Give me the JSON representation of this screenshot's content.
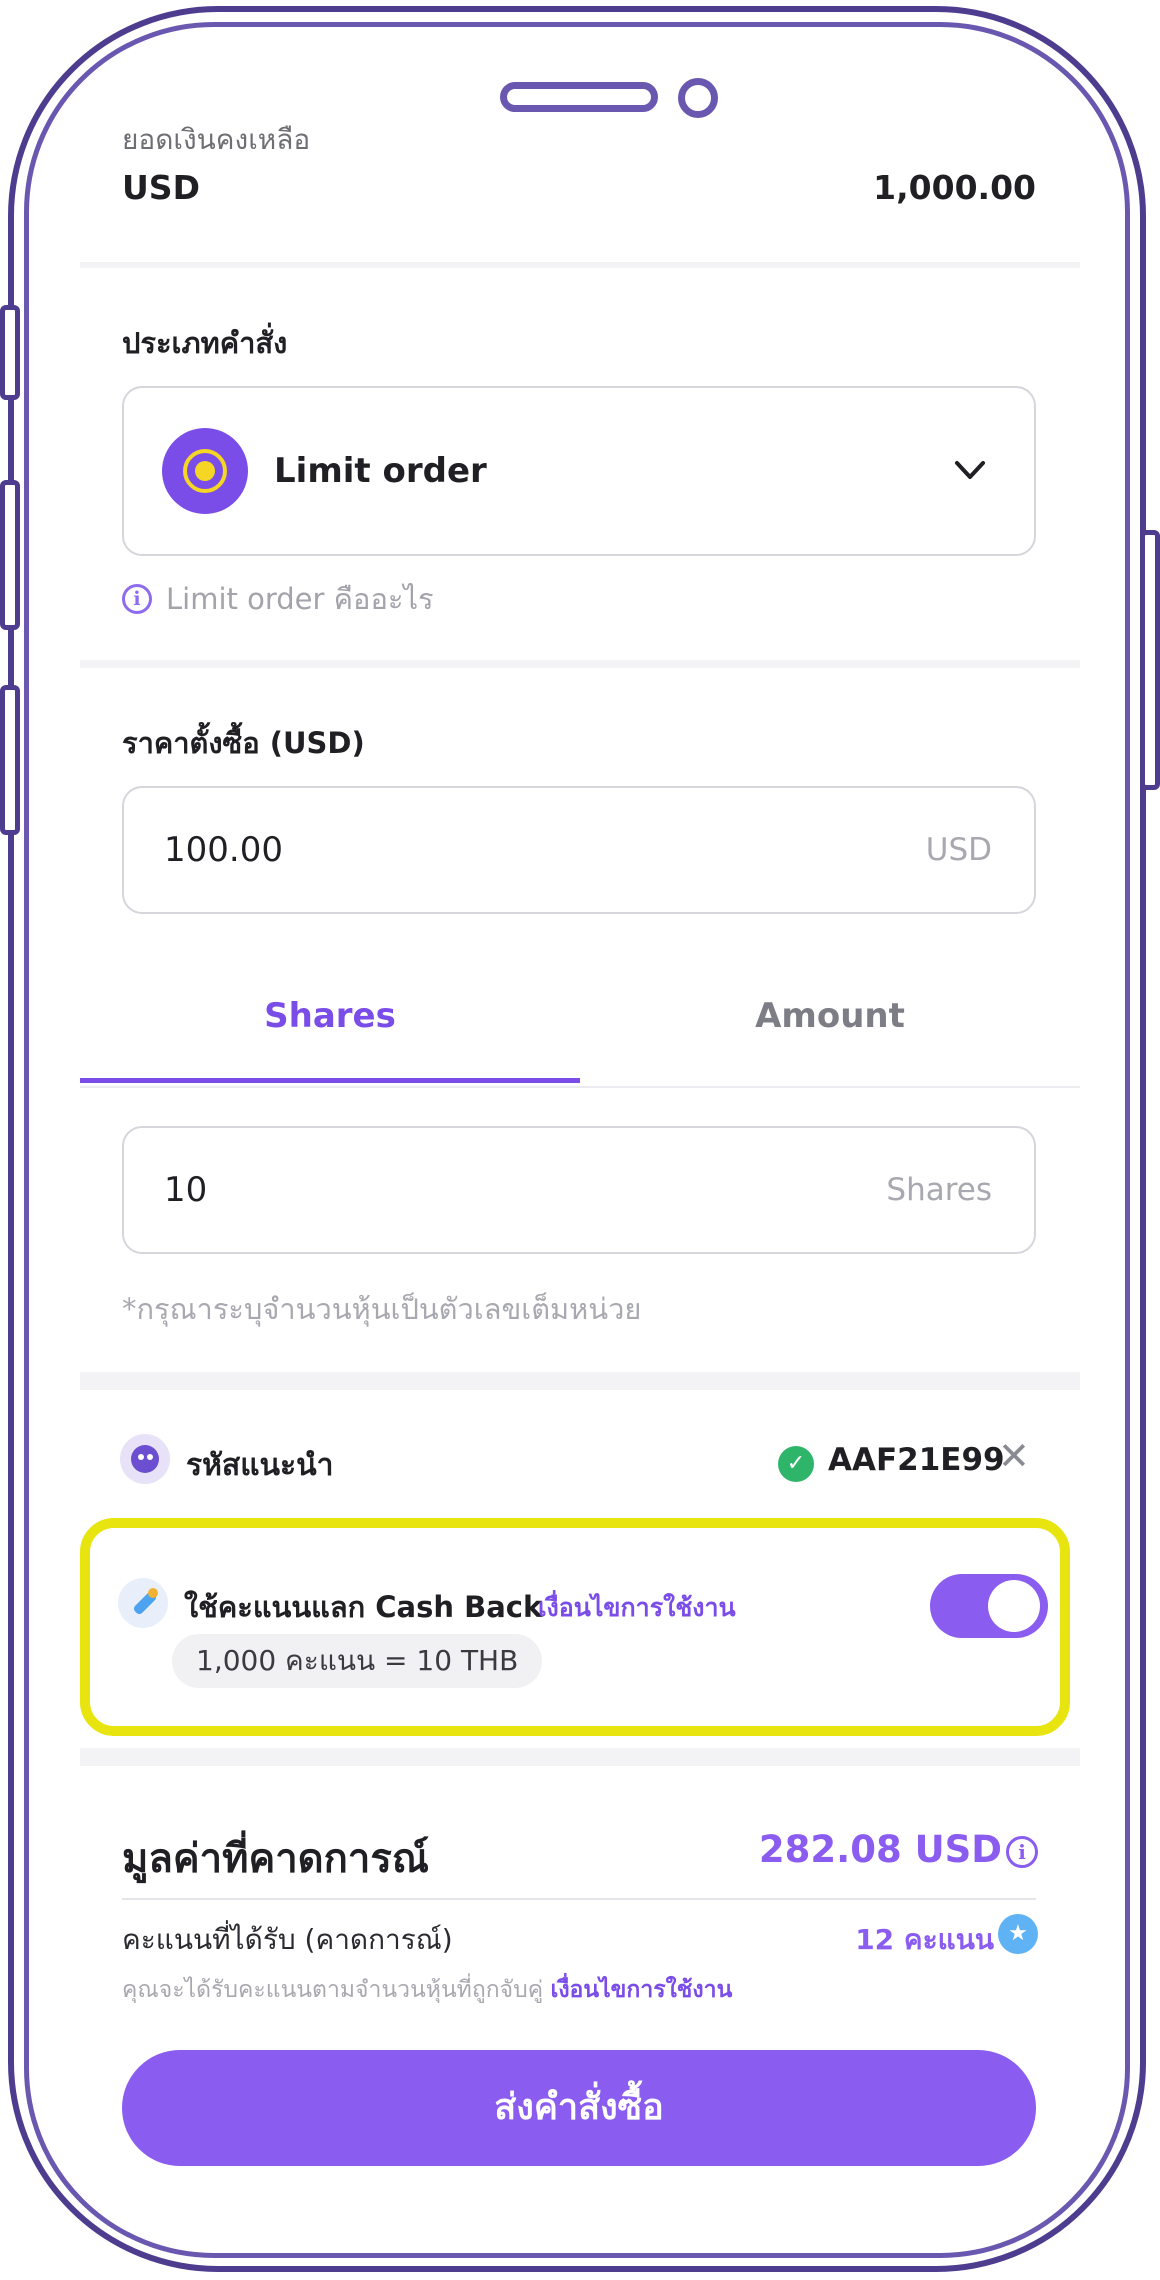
{
  "balance": {
    "label": "ยอดเงินคงเหลือ",
    "currency": "USD",
    "amount": "1,000.00"
  },
  "order_type": {
    "title": "ประเภทคำสั่ง",
    "selected": "Limit order",
    "info_link": "Limit order คืออะไร",
    "icon": "target-radio-icon"
  },
  "limit_price": {
    "title": "ราคาตั้งซื้อ (USD)",
    "value": "100.00",
    "unit": "USD"
  },
  "tabs": {
    "items": [
      {
        "label": "Shares",
        "active": true
      },
      {
        "label": "Amount",
        "active": false
      }
    ]
  },
  "quantity": {
    "value": "10",
    "unit": "Shares",
    "hint": "*กรุณาระบุจำนวนหุ้นเป็นตัวเลขเต็มหน่วย"
  },
  "referral": {
    "label": "รหัสแนะนำ",
    "code": "AAF21E99",
    "status_color": "#2fb56a"
  },
  "cashback": {
    "label": "ใช้คะแนนแลก Cash Back",
    "terms_link": "เงื่อนไขการใช้งาน",
    "rate": "1,000 คะแนน = 10 THB",
    "toggle_on": true,
    "highlight_color": "#e8e40f"
  },
  "estimate": {
    "title": "มูลค่าที่คาดการณ์",
    "value": "282.08 USD",
    "points_label": "คะแนนที่ได้รับ (คาดการณ์)",
    "points_value": "12 คะแนน",
    "note": "คุณจะได้รับคะแนนตามจำนวนหุ้นที่ถูกจับคู่",
    "note_link": "เงื่อนไขการใช้งาน"
  },
  "submit": {
    "label": "ส่งคำสั่งซื้อ"
  },
  "colors": {
    "accent": "#7a4de8",
    "button": "#8a5cf0",
    "phone_frame": "#4e3c8f"
  }
}
